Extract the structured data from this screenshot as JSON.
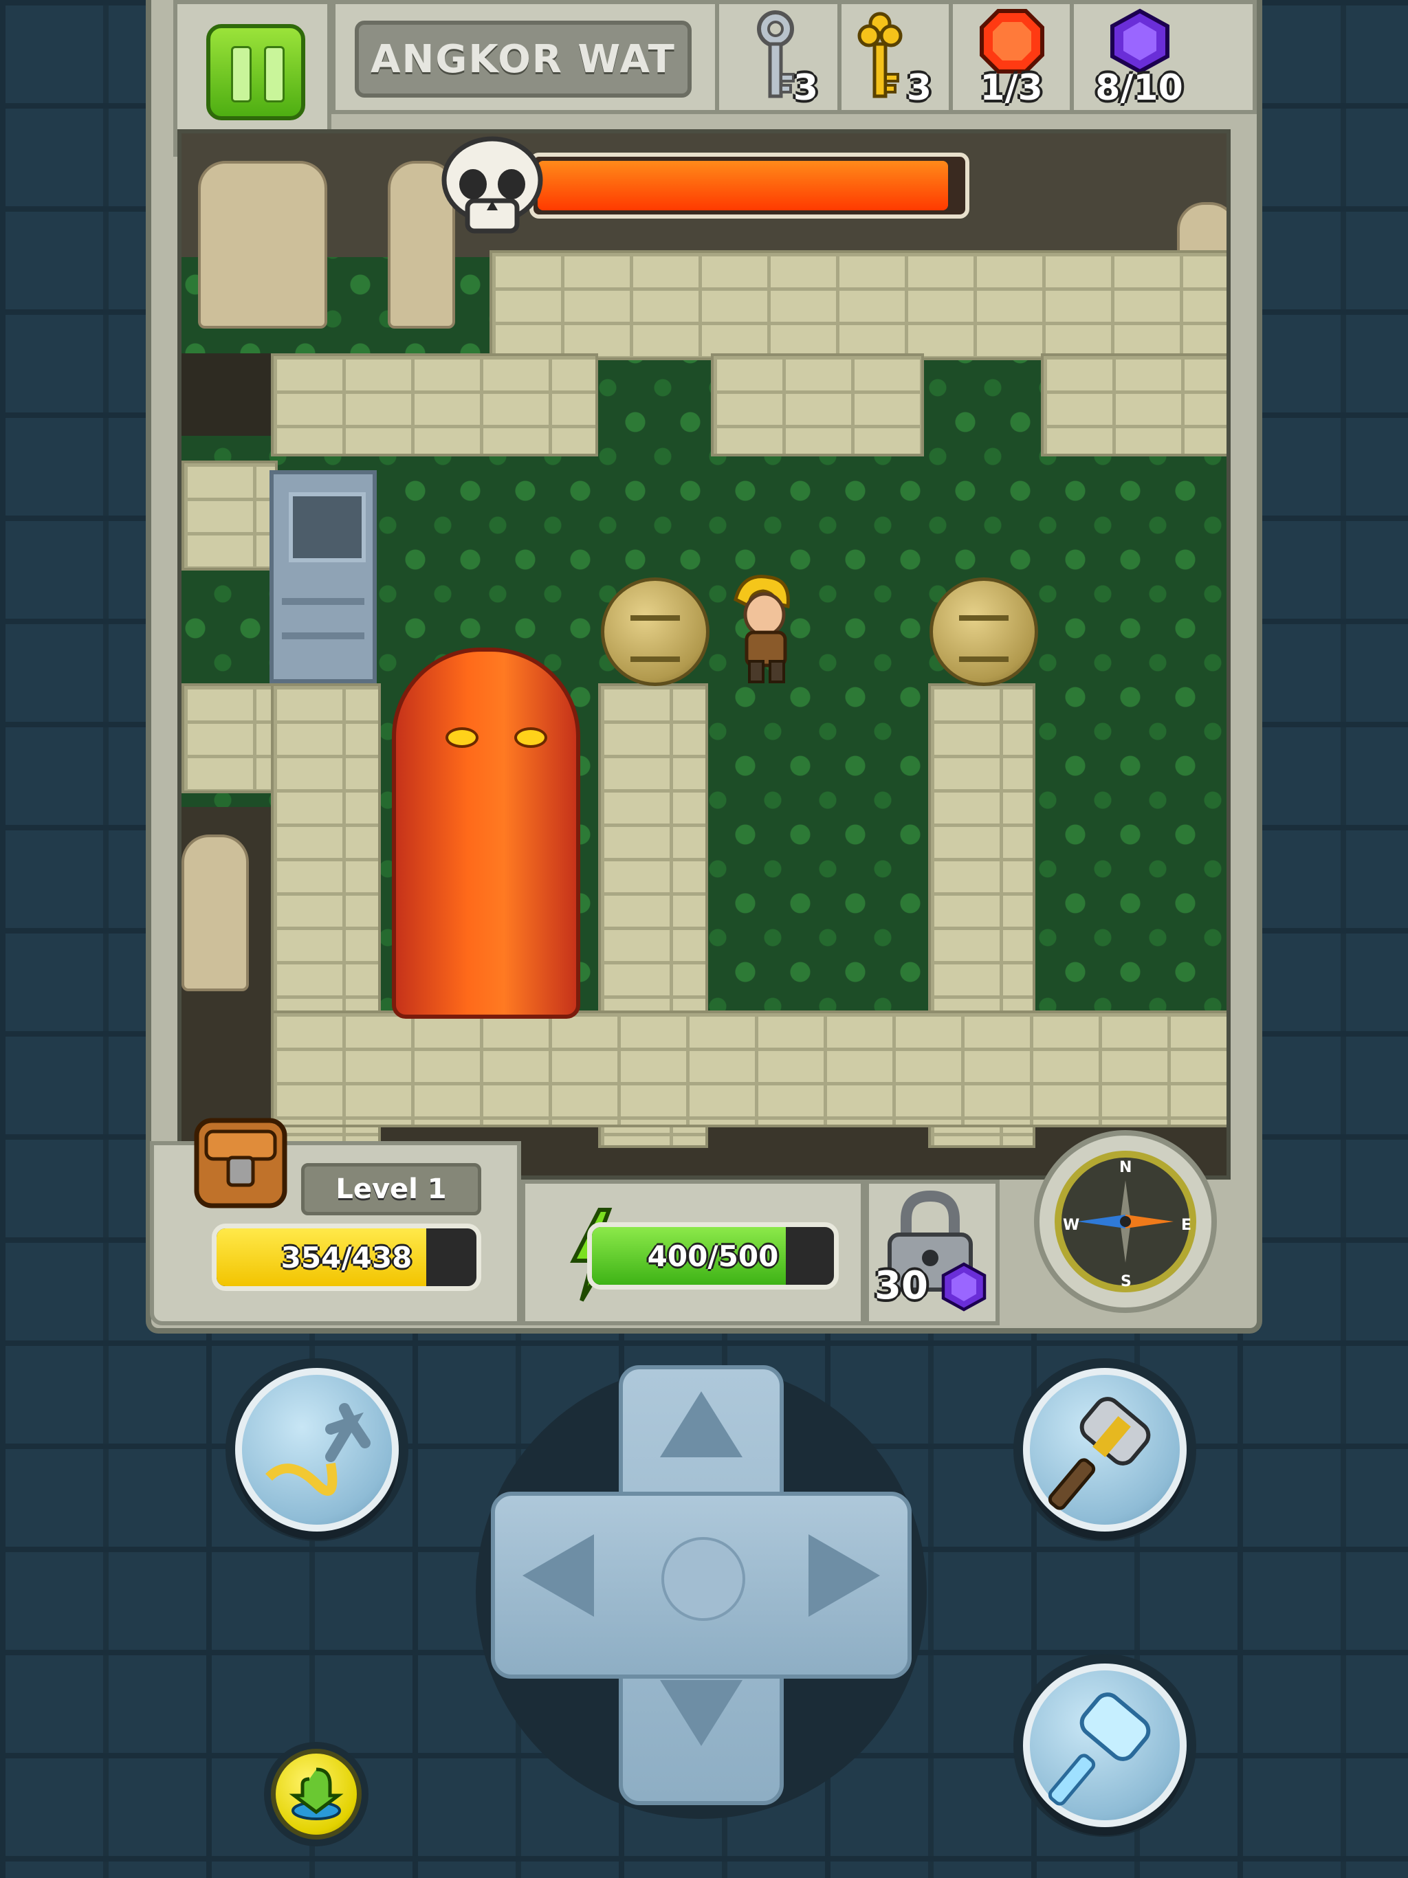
{
  "hud": {
    "location_name": "ANGKOR WAT",
    "silver_keys": "3",
    "gold_keys": "3",
    "red_gems": "1/3",
    "purple_gems": "8/10"
  },
  "boss": {
    "health_fraction": 0.95
  },
  "player": {
    "level_label": "Level 1",
    "xp_text": "354/438",
    "xp_fraction": 0.808,
    "energy_text": "400/500",
    "energy_fraction": 0.8,
    "unlock_cost": "30"
  },
  "compass": {
    "north": "N",
    "south": "S",
    "east": "E",
    "west": "W"
  },
  "icons": {
    "pause": "pause-icon",
    "silver_key": "silver-key-icon",
    "gold_key": "gold-key-icon",
    "red_gem": "red-gem-icon",
    "purple_gem": "purple-gem-icon",
    "skull": "skull-icon",
    "backpack": "backpack-icon",
    "lightning": "lightning-icon",
    "lock": "padlock-icon",
    "grappling_hook": "grappling-hook-icon",
    "hammer": "hammer-icon",
    "ice_hammer": "ice-hammer-icon",
    "download": "download-icon"
  },
  "colors": {
    "boss_bar": "#ff4a00",
    "xp_bar": "#f5cc00",
    "energy_bar": "#56c41e",
    "pause_button": "#6cc720"
  }
}
